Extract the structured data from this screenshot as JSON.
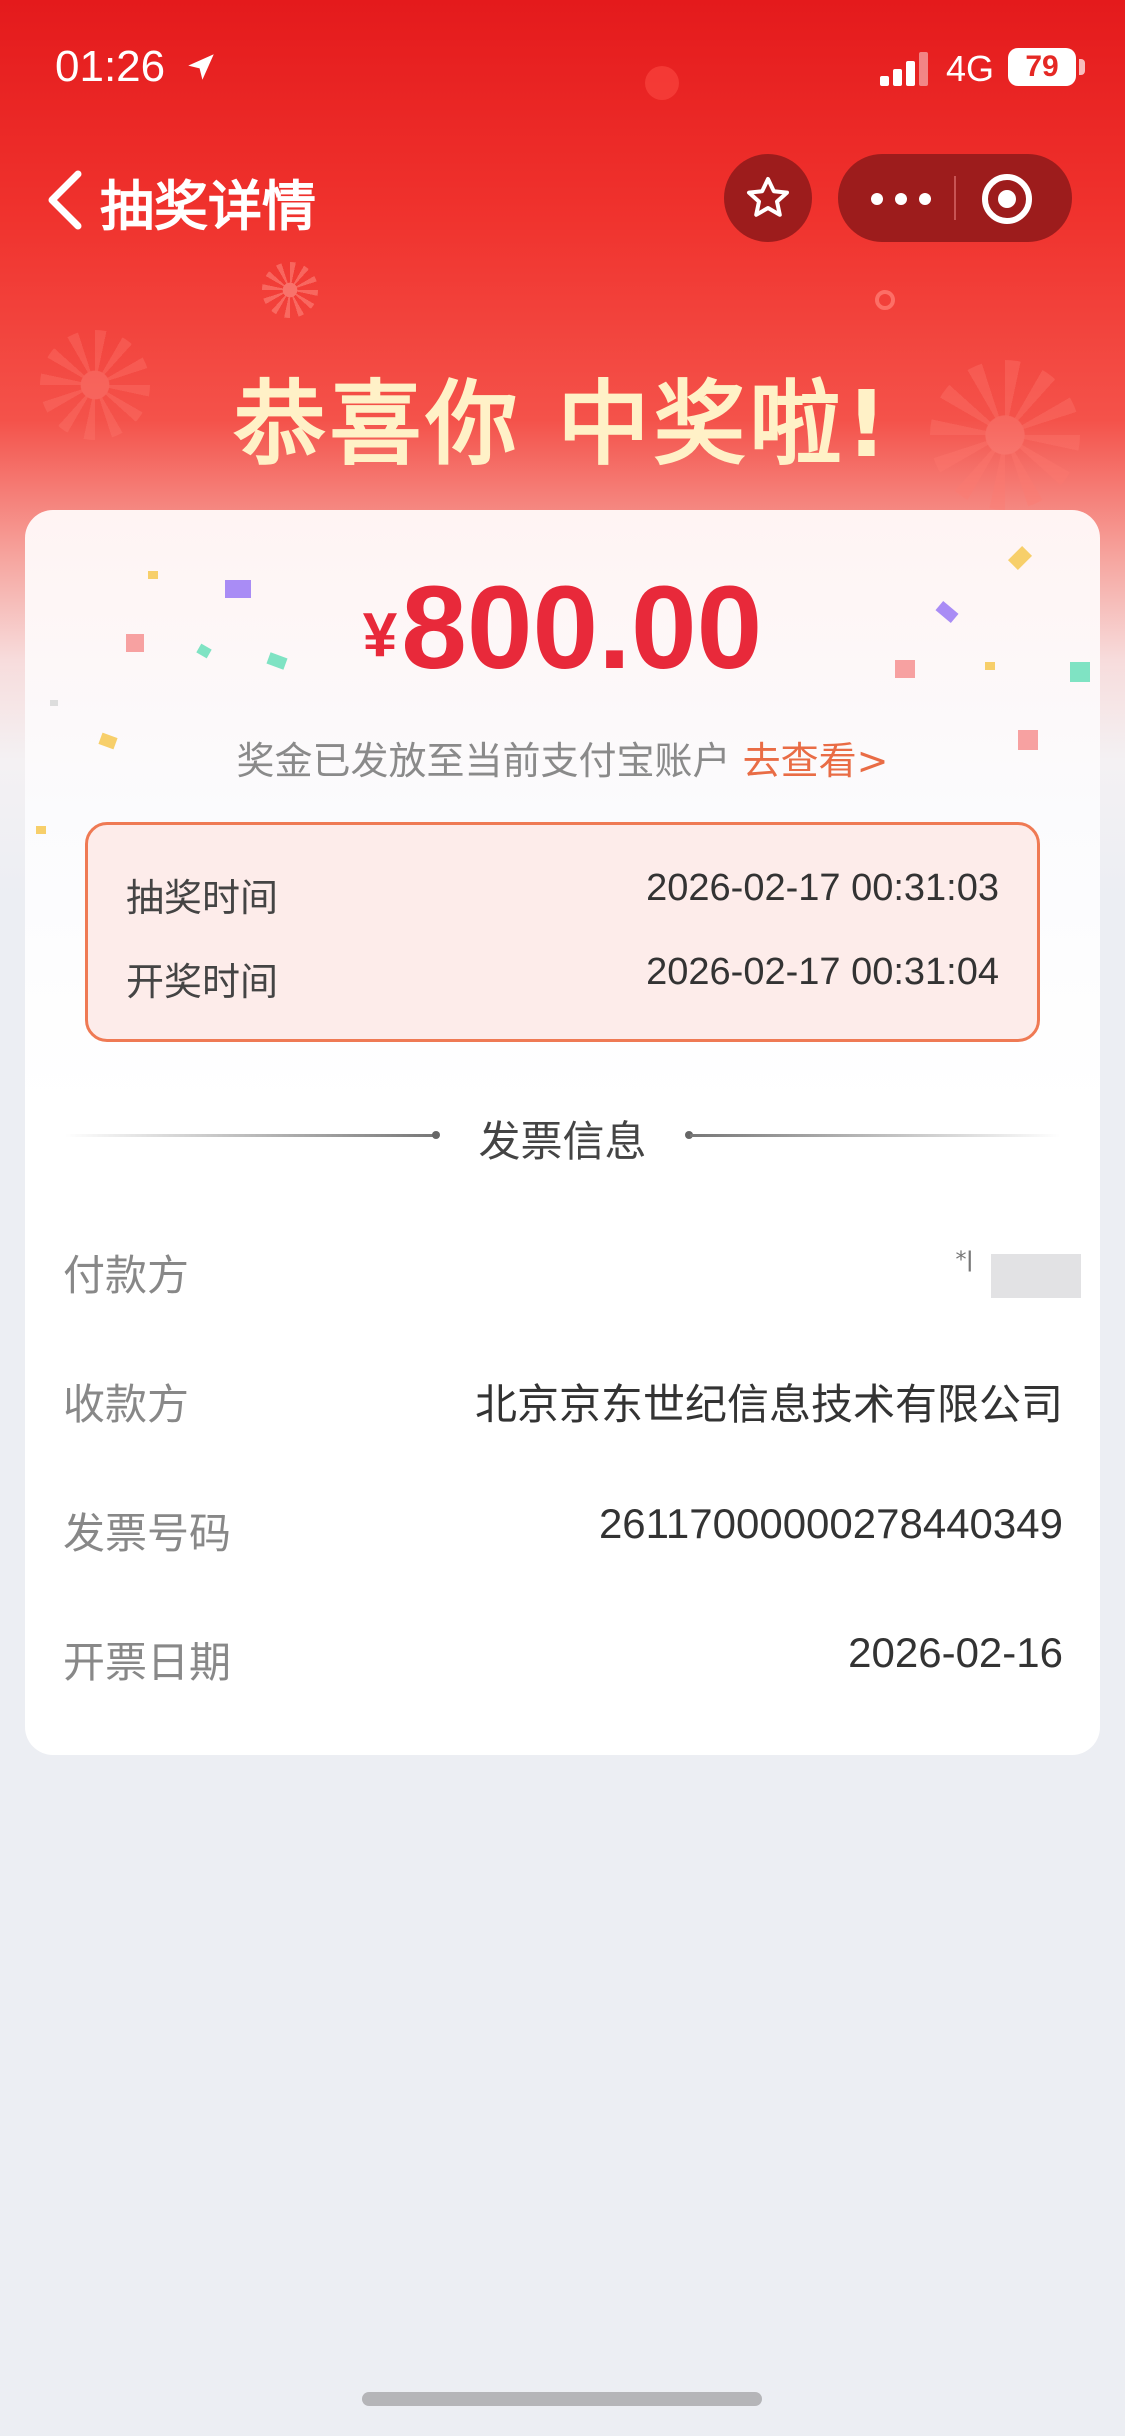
{
  "status_bar": {
    "time": "01:26",
    "network": "4G",
    "battery": "79"
  },
  "nav": {
    "title": "抽奖详情"
  },
  "banner": {
    "congrats": "恭喜你 中奖啦!"
  },
  "prize": {
    "currency": "¥",
    "amount": "800.00",
    "note": "奖金已发放至当前支付宝账户",
    "link": "去查看>"
  },
  "times": {
    "draw_label": "抽奖时间",
    "draw_value": "2026-02-17 00:31:03",
    "open_label": "开奖时间",
    "open_value": "2026-02-17 00:31:04"
  },
  "invoice": {
    "title": "发票信息",
    "rows": [
      {
        "label": "付款方",
        "value": ""
      },
      {
        "label": "收款方",
        "value": "北京京东世纪信息技术有限公司"
      },
      {
        "label": "发票号码",
        "value": "26117000000278440349"
      },
      {
        "label": "开票日期",
        "value": "2026-02-16"
      }
    ]
  },
  "colors": {
    "accent_red": "#e8293a",
    "link_orange": "#e96c45",
    "header_red": "#e41a1c"
  }
}
